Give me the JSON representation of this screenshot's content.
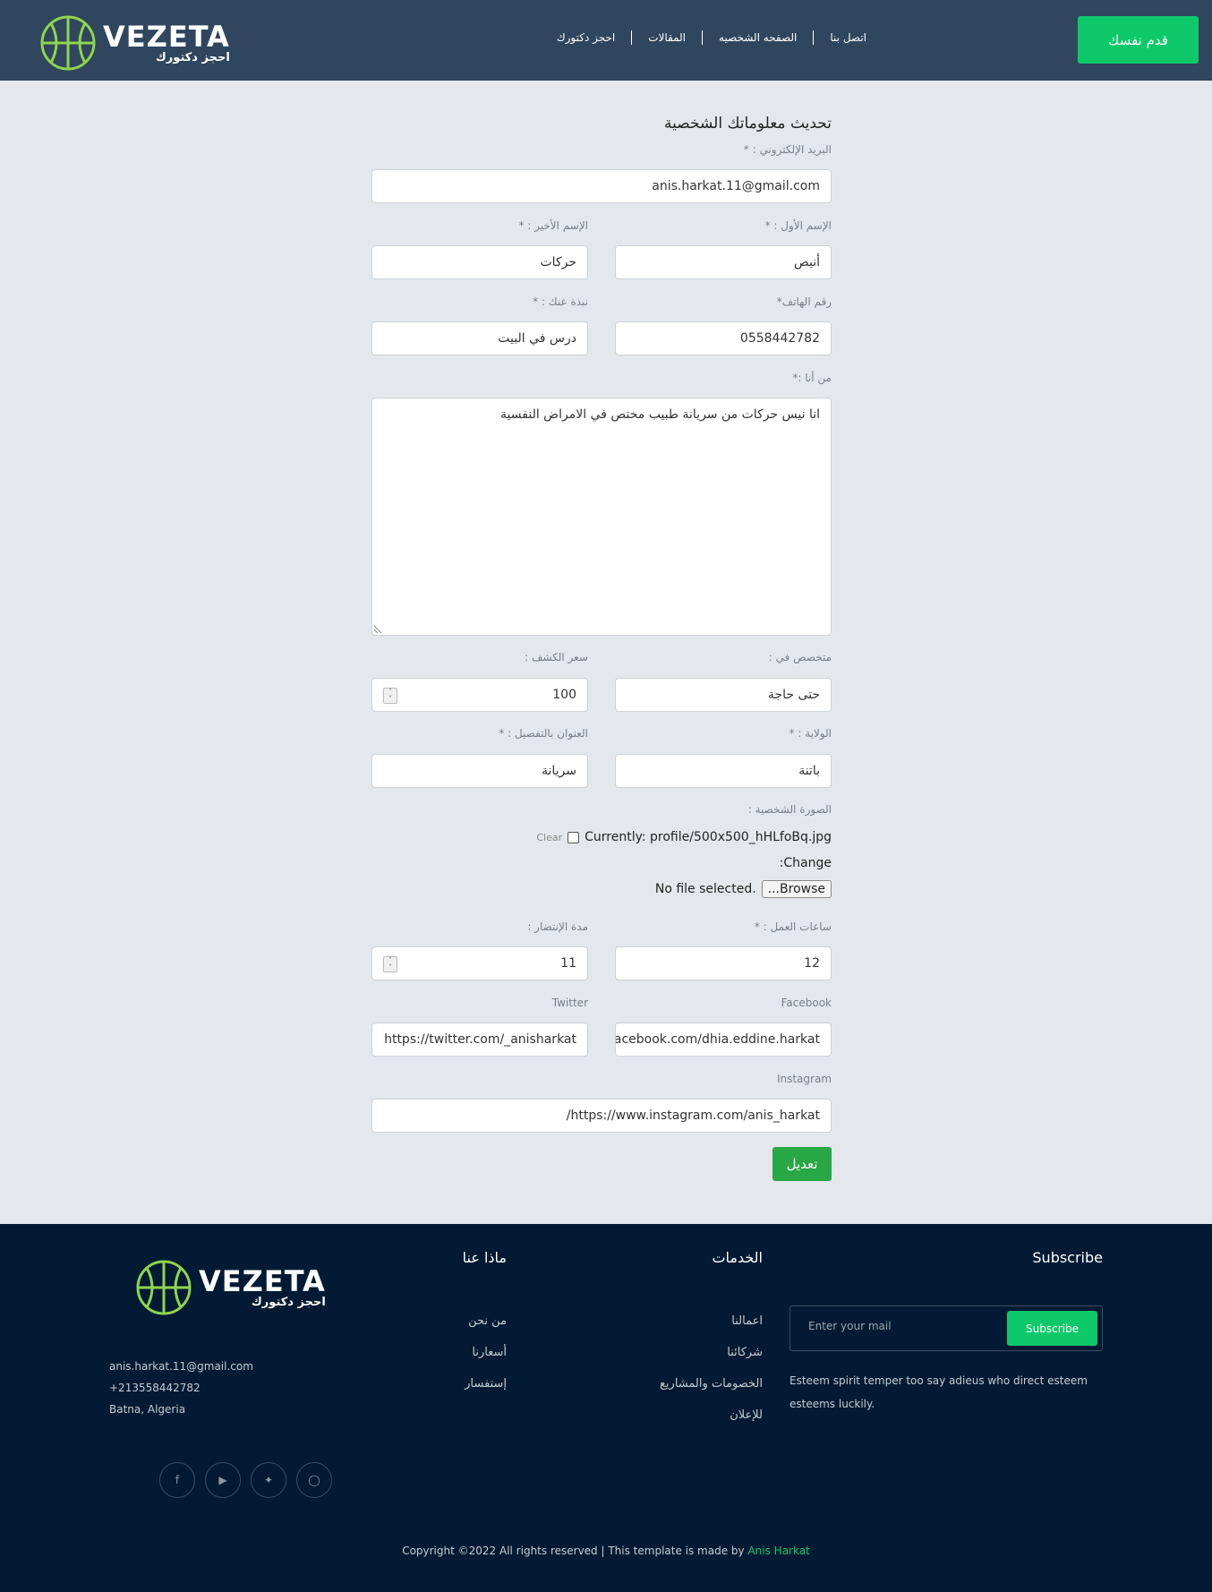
{
  "header": {
    "logo_text": "VEZETA",
    "logo_subtitle": "احجز دكتورك",
    "nav": [
      "اتصل بنا",
      "الصفحه الشخصيه",
      "المقالات",
      "احجز دكتورك"
    ],
    "cta": "قدم نفسك"
  },
  "form": {
    "title": "تحديث معلوماتك الشخصية",
    "email_label": "البريد الإلكتروني : *",
    "email_value": "anis.harkat.11@gmail.com",
    "first_name_label": "الإسم الأول : *",
    "first_name_value": "أنيص",
    "last_name_label": "الإسم الأخير : *",
    "last_name_value": "حركات",
    "phone_label": "رقم الهاتف*",
    "phone_value": "0558442782",
    "bio_short_label": "نبذة عنك : *",
    "bio_short_value": "درس في البيت",
    "about_label": "من أنا :*",
    "about_value": "انا نيس حركات من سريانة طبيب مختص في الامراض النفسية",
    "specialty_label": "متخصص في :",
    "specialty_value": "حتى حاجة",
    "price_label": "سعر الكشف :",
    "price_value": "100",
    "state_label": "الولاية : *",
    "state_value": "باتنة",
    "address_label": "العنوان بالتفصيل : *",
    "address_value": "سريانة",
    "photo_label": "الصورة الشخصية :",
    "currently_text": "Currently: profile/500x500_hHLfoBq.jpg",
    "clear_text": "Clear",
    "change_text": "Change:",
    "browse_label": "Browse...",
    "no_file_text": "No file selected.",
    "hours_label": "ساعات العمل : *",
    "hours_value": "12",
    "wait_label": "مدة الإنتضار :",
    "wait_value": "11",
    "facebook_label": "Facebook",
    "facebook_value": "https://www.facebook.com/dhia.eddine.harkat",
    "twitter_label": "Twitter",
    "twitter_value": "https://twitter.com/_anisharkat",
    "instagram_label": "Instagram",
    "instagram_value": "https://www.instagram.com/anis_harkat/",
    "submit_label": "تعديل"
  },
  "footer": {
    "logo_text": "VEZETA",
    "logo_subtitle": "احجز دكتورك",
    "contact": [
      "anis.harkat.11@gmail.com",
      "+213558442782",
      "Batna, Algeria"
    ],
    "socials": [
      "facebook-icon",
      "youtube-icon",
      "twitter-icon",
      "instagram-icon"
    ],
    "about_title": "ماذا عنا",
    "about_links": [
      "من نحن",
      "أسعارنا",
      "إستفسار"
    ],
    "services_title": "الخدمات",
    "services_links": [
      "اعمالنا",
      "شركائنا",
      "الخصومات والمشاريع",
      "للإعلان"
    ],
    "subscribe_title": "Subscribe",
    "subscribe_placeholder": "Enter your mail",
    "subscribe_button": "Subscribe",
    "subscribe_desc": "Esteem spirit temper too say adieus who direct esteem esteems luckily.",
    "copyright": "Copyright ©2022 All rights reserved | This template is made by",
    "author": "Anis Harkat"
  },
  "colors": {
    "header_bg": "#2f465e",
    "accent": "#0ec96a",
    "submit": "#28a745",
    "footer_bg": "#021a33",
    "logo_green": "#8fd44e"
  }
}
